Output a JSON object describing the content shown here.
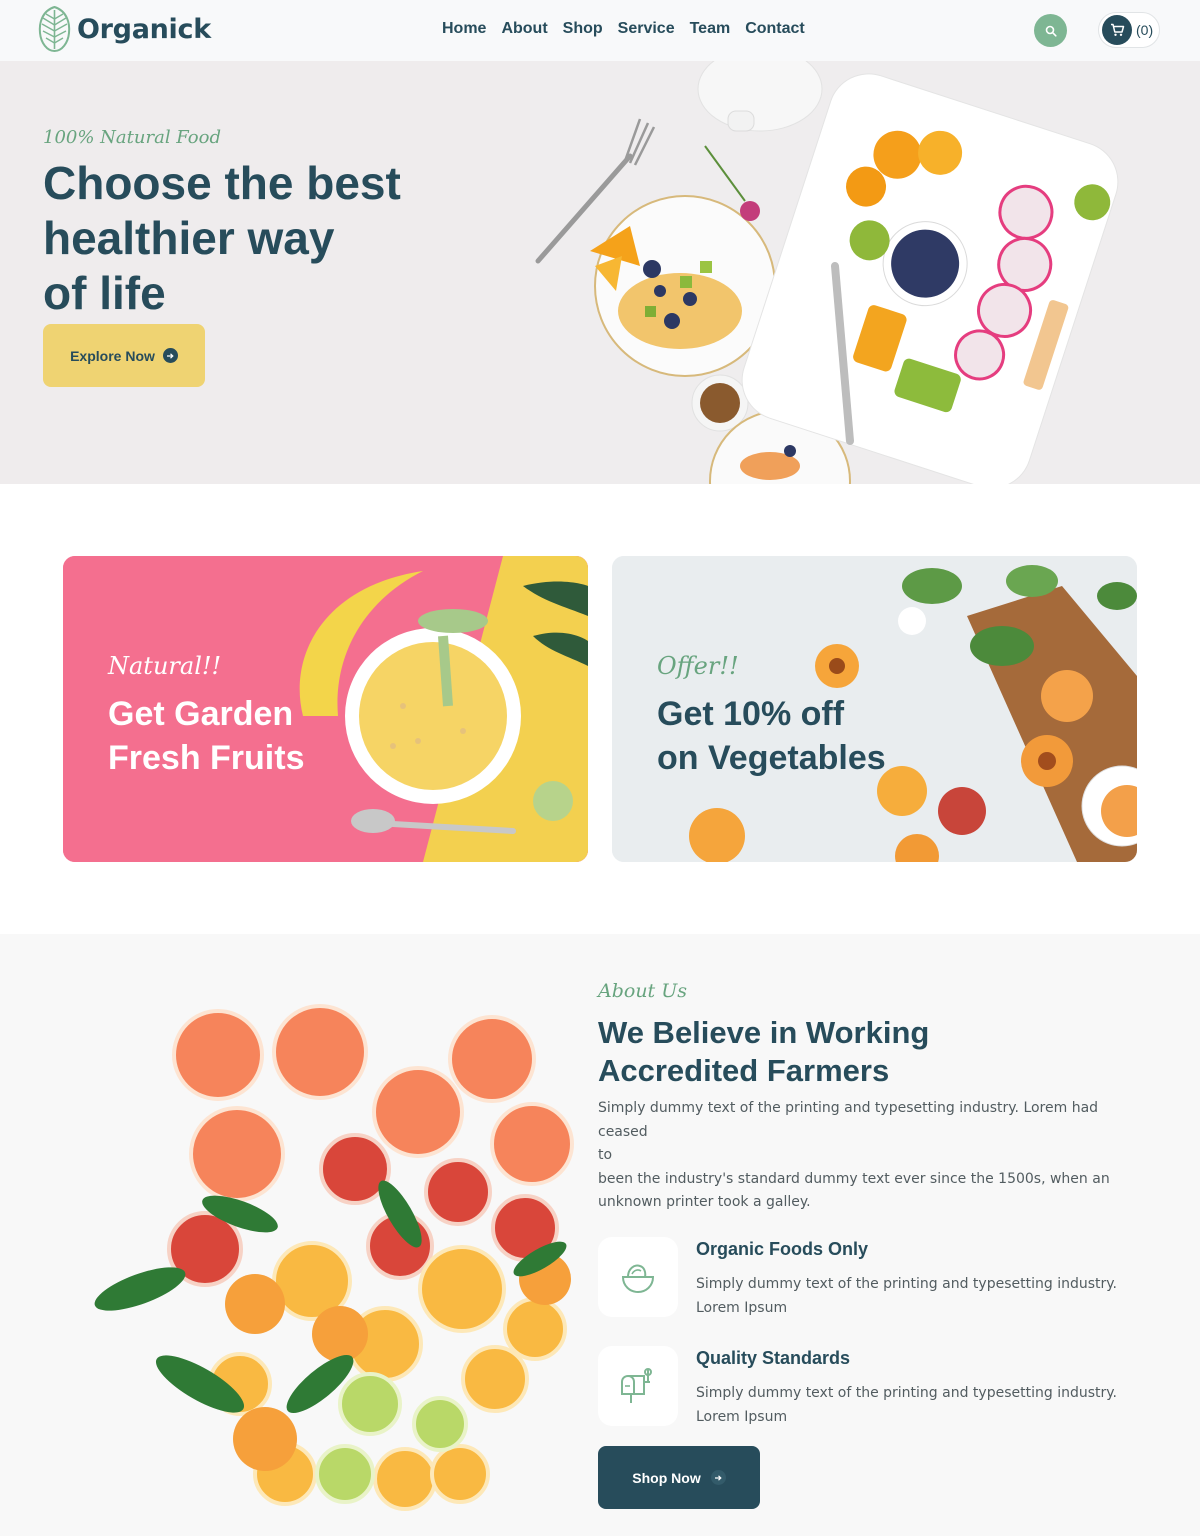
{
  "brand": {
    "name": "Organick"
  },
  "nav": {
    "items": [
      "Home",
      "About",
      "Shop",
      "Service",
      "Team",
      "Contact"
    ]
  },
  "cart": {
    "count_label": "(0)"
  },
  "hero": {
    "subtitle": "100% Natural Food",
    "title_line1": "Choose the best",
    "title_line2": "healthier way",
    "title_line3": "of life",
    "button_label": "Explore Now"
  },
  "offers": [
    {
      "script": "Natural!!",
      "title_line1": "Get Garden",
      "title_line2": "Fresh Fruits"
    },
    {
      "script": "Offer!!",
      "title_line1": "Get 10% off",
      "title_line2": "on Vegetables"
    }
  ],
  "about": {
    "subtitle": "About Us",
    "title_line1": "We Believe in Working",
    "title_line2": "Accredited Farmers",
    "desc_line1": "Simply dummy text of the printing and typesetting industry. Lorem had ceased",
    "desc_line2": "to",
    "desc_line3": "been the industry's standard dummy text ever since the 1500s, when an",
    "desc_line4": "unknown printer took a galley.",
    "features": [
      {
        "title": "Organic Foods Only",
        "text_line1": "Simply dummy text of the printing and typesetting industry.",
        "text_line2": "Lorem Ipsum",
        "icon": "bowl-icon"
      },
      {
        "title": "Quality Standards",
        "text_line1": "Simply dummy text of the printing and typesetting industry.",
        "text_line2": "Lorem Ipsum",
        "icon": "mailbox-icon"
      }
    ],
    "button_label": "Shop Now"
  },
  "colors": {
    "primary": "#274C5B",
    "accent_green": "#7EB693",
    "accent_yellow": "#EFD372",
    "pink": "#F46F8F"
  }
}
